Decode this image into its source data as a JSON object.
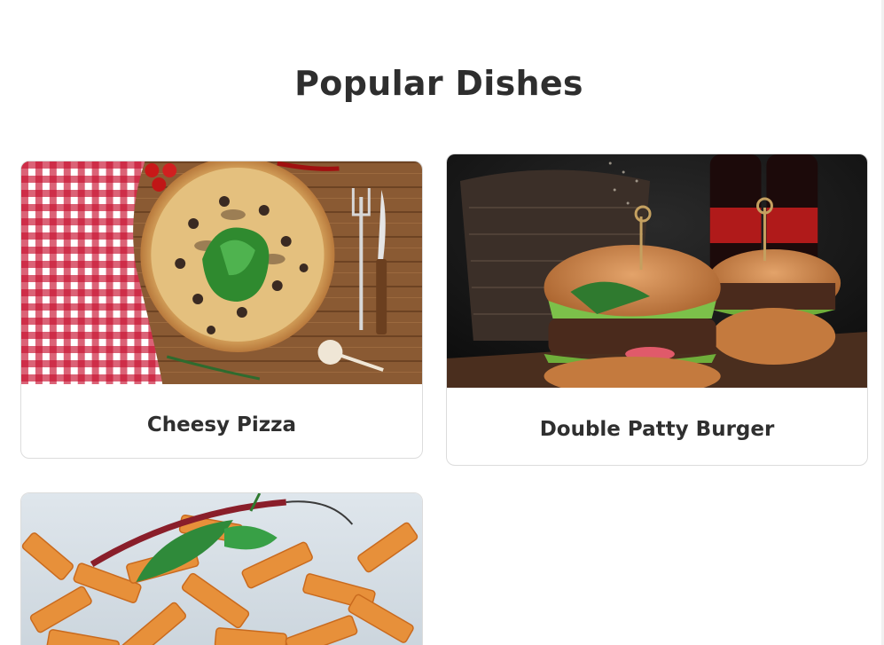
{
  "section": {
    "title": "Popular Dishes"
  },
  "dishes": [
    {
      "name": "Cheesy Pizza",
      "image": "pizza-photo"
    },
    {
      "name": "Double Patty Burger",
      "image": "burger-photo"
    },
    {
      "name": "",
      "image": "pasta-photo"
    }
  ],
  "colors": {
    "title": "#2e2e2e",
    "card_border": "#dcdcdc",
    "background": "#ffffff"
  }
}
